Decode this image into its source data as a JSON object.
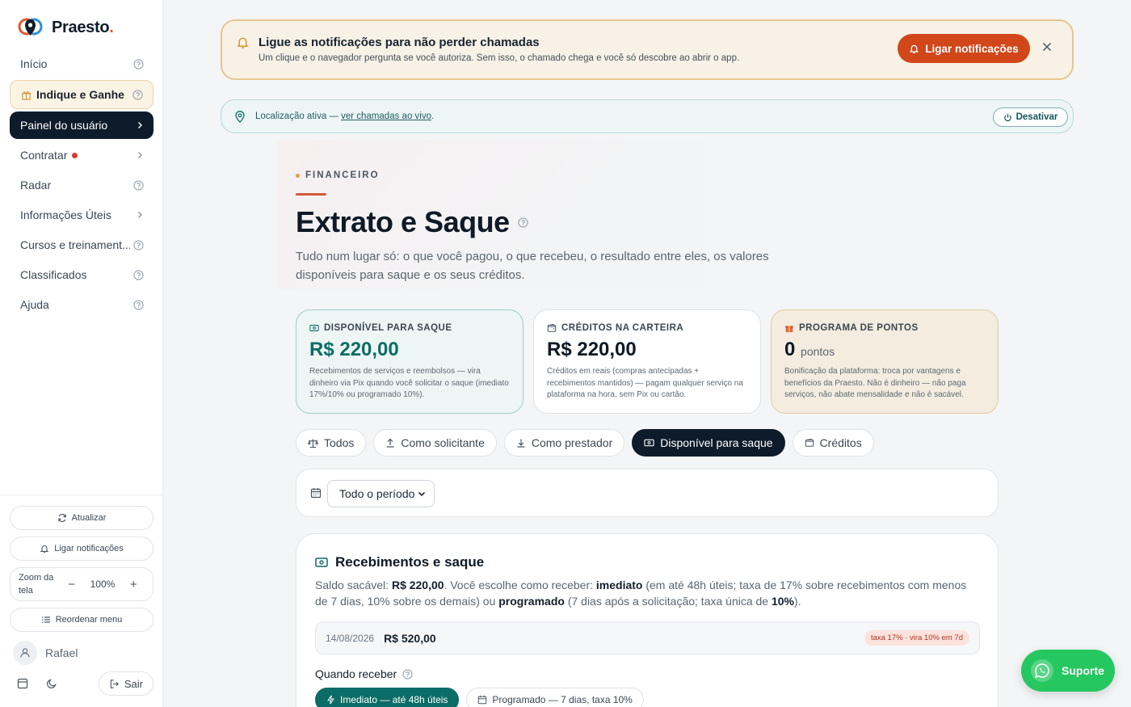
{
  "brand": {
    "name": "Praesto",
    "dot": "."
  },
  "sidebar": {
    "items": [
      {
        "label": "Início"
      },
      {
        "label": "Indique e Ganhe"
      },
      {
        "label": "Painel do usuário"
      },
      {
        "label": "Contratar"
      },
      {
        "label": "Radar"
      },
      {
        "label": "Informações Úteis"
      },
      {
        "label": "Cursos e treinament..."
      },
      {
        "label": "Classificados"
      },
      {
        "label": "Ajuda"
      }
    ],
    "refresh_label": "Atualizar",
    "notify_label": "Ligar notificações",
    "zoom_label": "Zoom da tela",
    "zoom_minus": "−",
    "zoom_value": "100%",
    "zoom_plus": "+",
    "reorder_label": "Reordenar menu",
    "user_name": "Rafael",
    "logout_label": "Sair"
  },
  "notification": {
    "title": "Ligue as notificações para não perder chamadas",
    "text": "Um clique e o navegador pergunta se você autoriza. Sem isso, o chamado chega e você só descobre ao abrir o app.",
    "cta": "Ligar notificações"
  },
  "location": {
    "prefix": "Localização ativa — ",
    "link": "ver chamadas ao vivo",
    "suffix": ".",
    "disable": "Desativar"
  },
  "page": {
    "eyebrow": "FINANCEIRO",
    "title": "Extrato e Saque",
    "lead": "Tudo num lugar só: o que você pagou, o que recebeu, o resultado entre eles, os valores disponíveis para saque e os seus créditos."
  },
  "cards": [
    {
      "title": "DISPONÍVEL PARA SAQUE",
      "value": "R$ 220,00",
      "desc": "Recebimentos de serviços e reembolsos — vira dinheiro via Pix quando você solicitar o saque (imediato 17%/10% ou programado 10%)."
    },
    {
      "title": "CRÉDITOS NA CARTEIRA",
      "value": "R$ 220,00",
      "desc": "Créditos em reais (compras antecipadas + recebimentos mantidos) — pagam qualquer serviço na plataforma na hora, sem Pix ou cartão."
    },
    {
      "title": "PROGRAMA DE PONTOS",
      "value": "0",
      "unit": "pontos",
      "desc": "Bonificação da plataforma: troca por vantagens e benefícios da Praesto. Não é dinheiro — não paga serviços, não abate mensalidade e não é sacável."
    }
  ],
  "filters": [
    "Todos",
    "Como solicitante",
    "Como prestador",
    "Disponível para saque",
    "Créditos"
  ],
  "period": {
    "selected": "Todo o período"
  },
  "panel": {
    "title": "Recebimentos e saque",
    "d1": "Saldo sacável: ",
    "d2": "R$ 220,00",
    "d3": ". Você escolhe como receber: ",
    "d4": "imediato",
    "d5": " (em até 48h úteis; taxa de 17% sobre recebimentos com menos de 7 dias, 10% sobre os demais) ou ",
    "d6": "programado",
    "d7": " (7 dias após a solicitação; taxa única de ",
    "d8": "10%",
    "d9": ").",
    "row_date": "14/08/2026",
    "row_amount": "R$ 520,00",
    "row_tag": "taxa 17% · vira 10% em 7d",
    "when_label": "Quando receber",
    "opt_immediate": "Imediato — até 48h úteis",
    "opt_scheduled": "Programado — 7 dias, taxa 10%"
  },
  "support": {
    "label": "Suporte"
  }
}
